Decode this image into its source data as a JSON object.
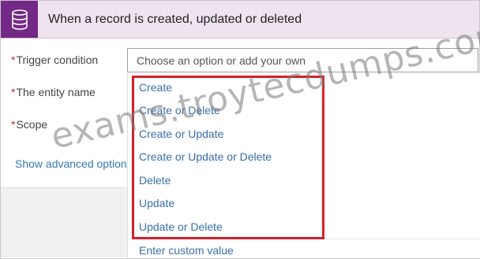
{
  "header": {
    "title": "When a record is created, updated or deleted",
    "icon": "database-icon",
    "accent_color": "#732a86"
  },
  "fields": {
    "trigger_condition": {
      "label": "Trigger condition",
      "placeholder": "Choose an option or add your own"
    },
    "entity_name": {
      "label": "The entity name"
    },
    "scope": {
      "label": "Scope"
    }
  },
  "required_marker": "*",
  "show_advanced_label": "Show advanced options",
  "dropdown": {
    "options": [
      "Create",
      "Create or Delete",
      "Create or Update",
      "Create or Update or Delete",
      "Delete",
      "Update",
      "Update or Delete"
    ],
    "custom_value": "Enter custom value",
    "highlight_color": "#d81f2b"
  },
  "watermark": "exams.troytecdumps.com"
}
